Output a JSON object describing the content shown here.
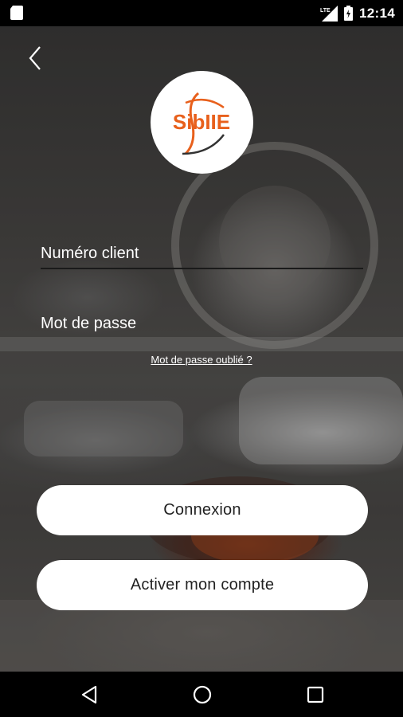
{
  "status_bar": {
    "time": "12:14",
    "network": "LTE",
    "icons": [
      "sd-card-icon",
      "lte-signal-icon",
      "battery-icon"
    ]
  },
  "header": {
    "back_icon": "chevron-left-icon"
  },
  "logo": {
    "text": "SibIIE",
    "accent_color": "#e8601c"
  },
  "form": {
    "client_number_placeholder": "Numéro client",
    "password_placeholder": "Mot de passe",
    "forgot_password_label": "Mot de passe oublié ?"
  },
  "actions": {
    "login_label": "Connexion",
    "activate_label": "Activer mon compte"
  },
  "nav_bar": {
    "icons": [
      "back-triangle-icon",
      "home-circle-icon",
      "recent-square-icon"
    ]
  }
}
